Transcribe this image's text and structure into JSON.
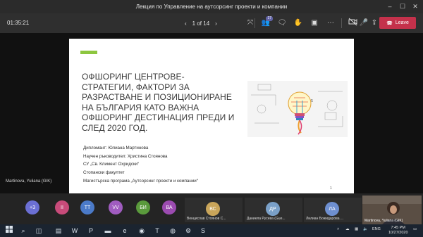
{
  "window": {
    "title": "Лекция по Управление на аутсорсинг проекти и компании"
  },
  "toolbar": {
    "timer": "01:35:21",
    "page_indicator": "1 of 14",
    "leave_label": "Leave",
    "participants_badge": "17"
  },
  "slide": {
    "heading": "ОФШОРИНГ ЦЕНТРОВЕ-СТРАТЕГИИ, ФАКТОРИ ЗА РАЗРАСТВАНЕ И ПОЗИЦИОНИРАНЕ НА БЪЛГАРИЯ КАТО ВАЖНА ОФШОРИНГ ДЕСТИНАЦИЯ ПРЕДИ И СЛЕД 2020 ГОД.",
    "meta": [
      "Дипломант: Юлиана Мартинова",
      "Научен ръководител: Христина Стоянова",
      "СУ „Св. Климент Охридски“",
      "Стопански факултет",
      "Магистърска програма „Аутсорсинг проекти и компании“"
    ],
    "page_number": "1",
    "accent_color": "#8dc63f"
  },
  "presenter": {
    "name": "Martinova, Yuliana (GIK)"
  },
  "participants": {
    "overflow": "+3",
    "avatars": [
      {
        "initials": "II",
        "color": "#c84b7a"
      },
      {
        "initials": "TT",
        "color": "#4b7ac8"
      },
      {
        "initials": "VV",
        "color": "#a05cc0"
      },
      {
        "initials": "БИ",
        "color": "#5a9a3c"
      },
      {
        "initials": "ВА",
        "color": "#9b4bb0"
      }
    ],
    "tiles": [
      {
        "initials": "ВС",
        "name": "Венцислав Стоянов С...",
        "color": "#c9a55a"
      },
      {
        "initials": "ДР",
        "name": "Даниела Русева (Gue...",
        "color": "#7aa0c8"
      },
      {
        "initials": "ЛА",
        "name": "Лилиан Божидарова ...",
        "color": "#6e8fd0"
      }
    ],
    "self_name": "Martinova, Yuliana (GIK)",
    "overflow_color": "#6b6fd4"
  },
  "taskbar": {
    "lang": "ENG",
    "time": "7:45 PM",
    "date": "10/27/2020"
  }
}
